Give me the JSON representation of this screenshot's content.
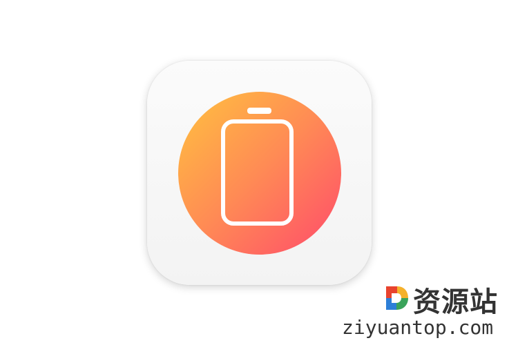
{
  "app_icon": {
    "icon_name": "battery-icon",
    "tile_color": "#f7f7f7",
    "gradient": [
      "#ffc23f",
      "#ff8a55",
      "#ff4a6b"
    ],
    "glyph_color": "#ffffff"
  },
  "watermark": {
    "logo_icon": "ziyuantop-logo-icon",
    "site_name_cn": "资源站",
    "site_url": "ziyuantop.com",
    "logo_colors": [
      "#e8432e",
      "#f5b12b",
      "#3aa35a",
      "#2d7fd8"
    ],
    "text_color": "#333333"
  }
}
